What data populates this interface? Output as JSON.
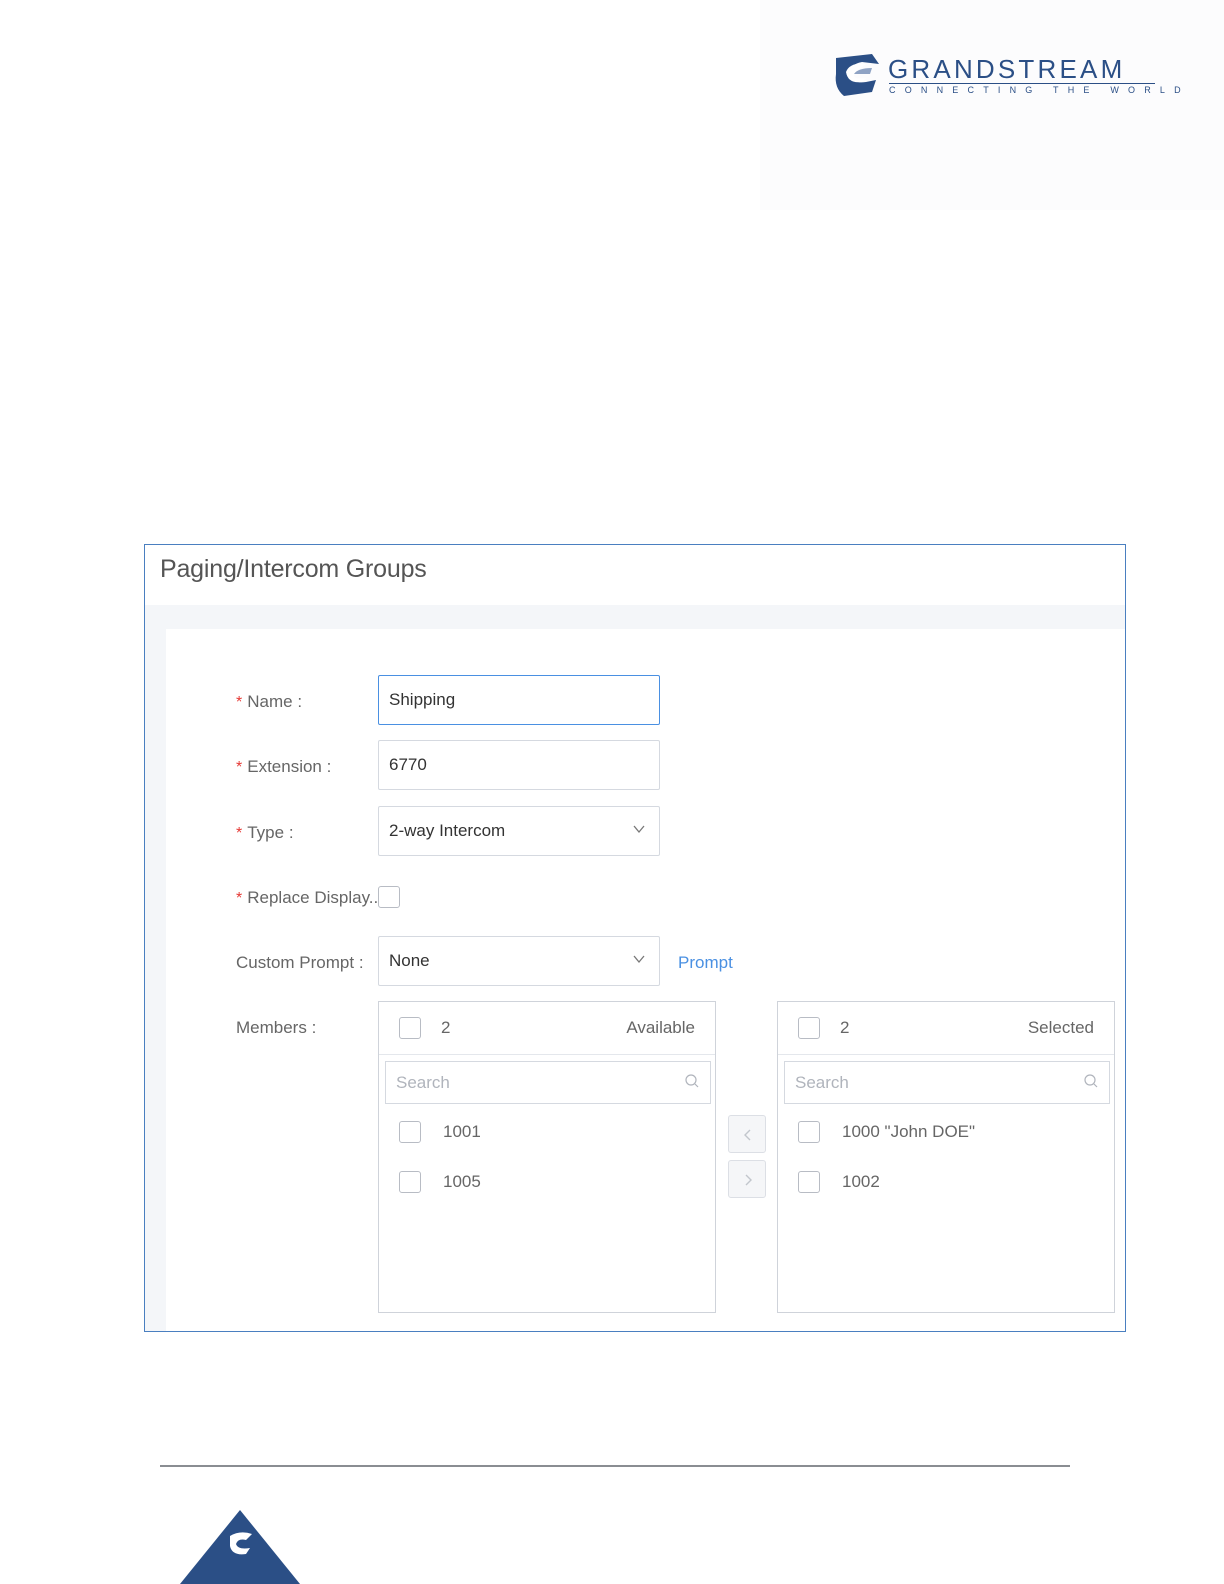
{
  "header": {
    "brand": "GRANDSTREAM",
    "tagline": "CONNECTING THE WORLD"
  },
  "panel": {
    "title": "Paging/Intercom Groups"
  },
  "form": {
    "name": {
      "label": "Name",
      "value": "Shipping",
      "required": true
    },
    "extension": {
      "label": "Extension",
      "value": "6770",
      "required": true
    },
    "type": {
      "label": "Type",
      "value": "2-way Intercom",
      "required": true
    },
    "replace_display": {
      "label": "Replace Display...",
      "checked": false,
      "required": true
    },
    "custom_prompt": {
      "label": "Custom Prompt",
      "value": "None",
      "link": "Prompt"
    },
    "members": {
      "label": "Members",
      "available": {
        "count": "2",
        "title": "Available",
        "search_placeholder": "Search",
        "items": [
          "1001",
          "1005"
        ]
      },
      "selected": {
        "count": "2",
        "title": "Selected",
        "search_placeholder": "Search",
        "items": [
          "1000 \"John DOE\"",
          "1002"
        ]
      }
    }
  },
  "colors": {
    "brand": "#2b4f86",
    "accent": "#4a90e2",
    "required": "#e53935",
    "panel_border": "#4a7fc0"
  }
}
